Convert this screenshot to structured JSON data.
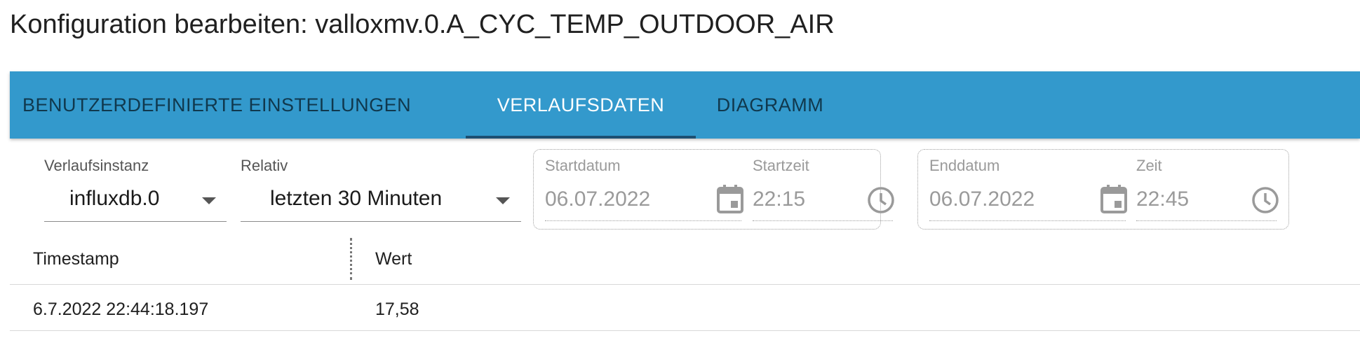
{
  "page": {
    "title": "Konfiguration bearbeiten: valloxmv.0.A_CYC_TEMP_OUTDOOR_AIR"
  },
  "tabs": [
    {
      "label": "BENUTZERDEFINIERTE EINSTELLUNGEN",
      "active": false
    },
    {
      "label": "VERLAUFSDATEN",
      "active": true
    },
    {
      "label": "DIAGRAMM",
      "active": false
    }
  ],
  "filters": {
    "instance": {
      "label": "Verlaufsinstanz",
      "value": "influxdb.0"
    },
    "relative": {
      "label": "Relativ",
      "value": "letzten 30 Minuten"
    },
    "start": {
      "date_label": "Startdatum",
      "date_value": "06.07.2022",
      "time_label": "Startzeit",
      "time_value": "22:15"
    },
    "end": {
      "date_label": "Enddatum",
      "date_value": "06.07.2022",
      "time_label": "Zeit",
      "time_value": "22:45"
    }
  },
  "table": {
    "columns": [
      "Timestamp",
      "Wert"
    ],
    "rows": [
      [
        "6.7.2022 22:44:18.197",
        "17,58"
      ]
    ]
  },
  "colors": {
    "tabbar": "#3399cc",
    "tab_indicator": "#1d4f72",
    "active_tab_text": "#ffffff",
    "inactive_tab_text": "#10384d"
  },
  "icons": {
    "date": "calendar-icon",
    "time": "clock-icon",
    "dropdown": "caret-down-icon"
  }
}
